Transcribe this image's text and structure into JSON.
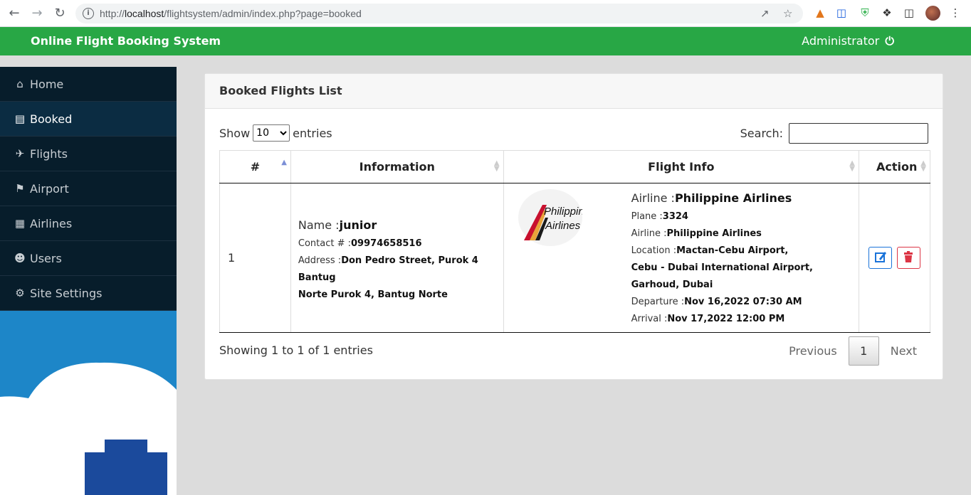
{
  "browser": {
    "url_prefix": "http://",
    "url_host": "localhost",
    "url_path": "/flightsystem/admin/index.php?page=booked"
  },
  "header": {
    "title": "Online Flight Booking System",
    "user": "Administrator"
  },
  "sidebar": {
    "items": [
      {
        "label": "Home",
        "icon": "home-icon"
      },
      {
        "label": "Booked",
        "icon": "book-icon"
      },
      {
        "label": "Flights",
        "icon": "plane-icon"
      },
      {
        "label": "Airport",
        "icon": "map-icon"
      },
      {
        "label": "Airlines",
        "icon": "building-icon"
      },
      {
        "label": "Users",
        "icon": "users-icon"
      },
      {
        "label": "Site Settings",
        "icon": "gear-icon"
      }
    ],
    "active": "Booked"
  },
  "card": {
    "title": "Booked Flights List",
    "show_label": "Show",
    "entries_label": "entries",
    "page_size": "10",
    "search_label": "Search:",
    "search_value": ""
  },
  "table": {
    "headers": [
      "#",
      "Information",
      "Flight Info",
      "Action"
    ],
    "rows": [
      {
        "num": "1",
        "name_label": "Name :",
        "name": "junior",
        "contact_label": "Contact # :",
        "contact": "09974658516",
        "address_label": "Address :",
        "address_line1": "Don Pedro Street, Purok 4 Bantug",
        "address_line2": "Norte Purok 4, Bantug Norte",
        "logo_text1": "Philippine",
        "logo_text2": "Airlines",
        "airline_label": "Airline :",
        "airline": "Philippine Airlines",
        "plane_label": "Plane :",
        "plane": "3324",
        "airline2_label": "Airline :",
        "airline2": "Philippine Airlines",
        "location_label": "Location :",
        "location_line1": "Mactan-Cebu Airport,",
        "location_line2": "Cebu - Dubai International Airport,",
        "location_line3": "Garhoud, Dubai",
        "departure_label": "Departure :",
        "departure": "Nov 16,2022 07:30 AM",
        "arrival_label": "Arrival :",
        "arrival": "Nov 17,2022 12:00 PM"
      }
    ]
  },
  "footer": {
    "info": "Showing 1 to 1 of 1 entries",
    "previous": "Previous",
    "current_page": "1",
    "next": "Next"
  },
  "colors": {
    "header_green": "#28a745",
    "sidebar_dark": "#071d2b",
    "edit_blue": "#1a73d9",
    "delete_red": "#dc3545"
  }
}
